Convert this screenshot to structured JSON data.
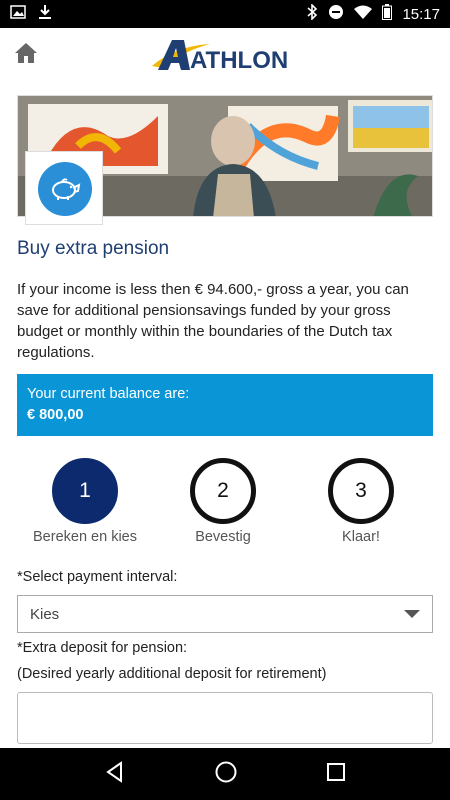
{
  "status_bar": {
    "time": "15:17",
    "left_icons": [
      "image-icon",
      "download-icon"
    ],
    "right_icons": [
      "bluetooth-icon",
      "do-not-disturb-icon",
      "wifi-icon",
      "battery-icon"
    ]
  },
  "header": {
    "logo_text": "ATHLON",
    "home_icon": "home-icon"
  },
  "banner": {
    "icon": "piggy-bank-icon",
    "colors": {
      "icon_circle": "#2b8fd8"
    }
  },
  "page": {
    "title": "Buy extra pension",
    "intro": "If your income is less then € 94.600,- gross a year, you can save for additional pensionsavings funded by your gross budget or monthly within the boundaries of the Dutch tax regulations."
  },
  "balance": {
    "label": "Your current balance are:",
    "amount": "€ 800,00",
    "color": "#0a96d6"
  },
  "steps": [
    {
      "number": "1",
      "label": "Bereken en kies",
      "active": true
    },
    {
      "number": "2",
      "label": "Bevestig",
      "active": false
    },
    {
      "number": "3",
      "label": "Klaar!",
      "active": false
    }
  ],
  "form": {
    "interval_label": "*Select payment interval:",
    "interval_value": "Kies",
    "deposit_label": "*Extra deposit for pension:",
    "deposit_hint": "(Desired yearly additional deposit for retirement)",
    "deposit_value": ""
  },
  "nav": [
    "back-icon",
    "home-circle-icon",
    "recents-icon"
  ]
}
